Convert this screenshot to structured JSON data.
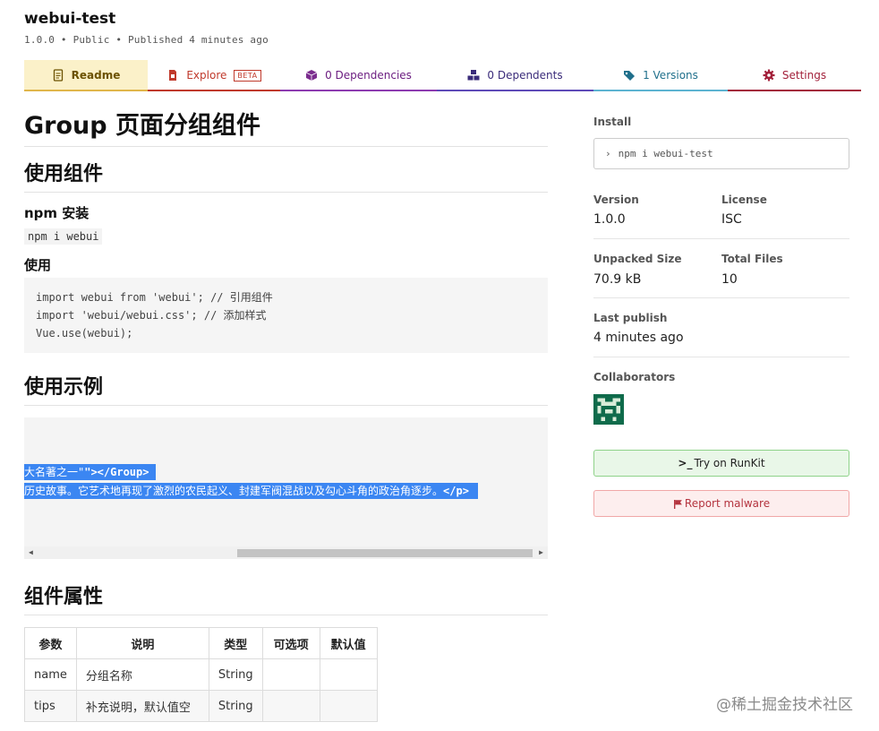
{
  "package": {
    "name": "webui-test",
    "meta": "1.0.0 • Public • Published 4 minutes ago"
  },
  "tabs": [
    {
      "label": "Readme",
      "icon": "readme-icon"
    },
    {
      "label": "Explore",
      "badge": "BETA",
      "icon": "explore-icon"
    },
    {
      "label": "0 Dependencies",
      "icon": "box-icon"
    },
    {
      "label": "0 Dependents",
      "icon": "cubes-icon"
    },
    {
      "label": "1 Versions",
      "icon": "tags-icon"
    },
    {
      "label": "Settings",
      "icon": "gear-icon"
    }
  ],
  "colors": {
    "readme": "#fbf1c9",
    "selection": "#3b86f2",
    "runkit_bg": "#e9f7e8",
    "malware_bg": "#fdeeee"
  },
  "readme": {
    "title": "Group 页面分组组件",
    "section_use": "使用组件",
    "npm_install_heading": "npm 安装",
    "npm_install_code": "npm i webui",
    "usage_heading": "使用",
    "usage_code": [
      "import webui from 'webui'; // 引用组件",
      "import 'webui/webui.css'; // 添加样式",
      "Vue.use(webui);"
    ],
    "section_example": "使用示例",
    "example_lines": [
      {
        "text": "大名著之一\"",
        "tag": "\"></Group>"
      },
      {
        "text": "历史故事。它艺术地再现了激烈的农民起义、封建军阀混战以及勾心斗角的政治角逐步。",
        "tag": "</p>"
      }
    ],
    "section_props": "组件属性",
    "props_table": {
      "headers": [
        "参数",
        "说明",
        "类型",
        "可选项",
        "默认值"
      ],
      "rows": [
        [
          "name",
          "分组名称",
          "String",
          "",
          ""
        ],
        [
          "tips",
          "补充说明，默认值空",
          "String",
          "",
          ""
        ]
      ]
    }
  },
  "sidebar": {
    "install_label": "Install",
    "install_cmd": "npm i webui-test",
    "version_label": "Version",
    "version": "1.0.0",
    "license_label": "License",
    "license": "ISC",
    "size_label": "Unpacked Size",
    "size": "70.9 kB",
    "files_label": "Total Files",
    "files": "10",
    "last_publish_label": "Last publish",
    "last_publish": "4 minutes ago",
    "collaborators_label": "Collaborators",
    "runkit_label": "Try on RunKit",
    "malware_label": "Report malware"
  },
  "watermark": "@稀土掘金技术社区"
}
